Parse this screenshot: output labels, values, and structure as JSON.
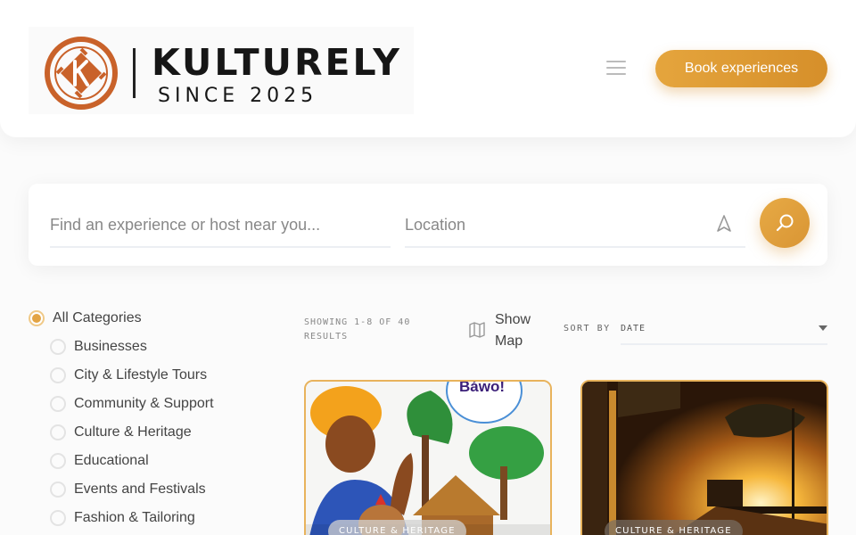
{
  "brand": {
    "name": "KULTURELY",
    "tagline": "SINCE 2025",
    "mark_letter": "K",
    "accent_color": "#c9622a"
  },
  "header": {
    "menu_icon": "hamburger-icon",
    "book_button_label": "Book experiences"
  },
  "search": {
    "query_placeholder": "Find an experience or host near you...",
    "location_placeholder": "Location",
    "locate_icon": "navigation-arrow-icon",
    "submit_icon": "search-icon"
  },
  "categories": [
    {
      "label": "All Categories",
      "selected": true
    },
    {
      "label": "Businesses",
      "selected": false
    },
    {
      "label": "City & Lifestyle Tours",
      "selected": false
    },
    {
      "label": "Community & Support",
      "selected": false
    },
    {
      "label": "Culture & Heritage",
      "selected": false
    },
    {
      "label": "Educational",
      "selected": false
    },
    {
      "label": "Events and Festivals",
      "selected": false
    },
    {
      "label": "Fashion & Tailoring",
      "selected": false
    }
  ],
  "results": {
    "showing_text": "SHOWING 1-8 OF 40 RESULTS",
    "show_map_label": "Show Map",
    "map_icon": "map-icon",
    "sort_by_label": "SORT BY",
    "sort_value": "DATE"
  },
  "cards": [
    {
      "badge": "CULTURE & HERITAGE",
      "speech_text": "Báwo!"
    },
    {
      "badge": "CULTURE & HERITAGE"
    }
  ],
  "colors": {
    "accent": "#e0a040",
    "card_border": "#e8b35c",
    "radio_selected": "#e3a444"
  }
}
